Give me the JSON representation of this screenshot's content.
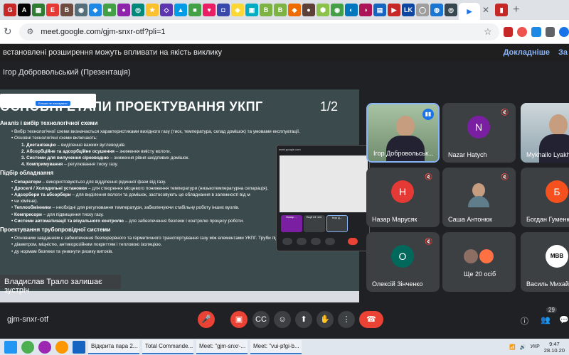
{
  "browser": {
    "url": "meet.google.com/gjm-snxr-otf?pli=1"
  },
  "banner": {
    "text": "встановлені розширення можуть впливати на якість виклику",
    "details_link": "Докладніше",
    "dismiss_link": "За"
  },
  "presenter_label": "Ігор Добровольський (Презентація)",
  "slide": {
    "title": "ОСНОВНІ ЕТАПИ ПРОЕКТУВАННЯ УКПГ",
    "page": "1/2",
    "popup_button": "Більше не показувати",
    "sections": [
      {
        "heading": "Аналіз і вибір технологічної схеми",
        "items": [
          {
            "level": 1,
            "bold": "",
            "text": "Вибір технологічної схеми визначається характеристиками вихідного газу (тиск, температура, склад домішок) та умовами експлуатації."
          },
          {
            "level": 1,
            "bold": "",
            "text": "Основні технологічні схеми включають:"
          },
          {
            "level": 2,
            "bold": "1. Деетанізацію",
            "text": " – виділення важких вуглеводнів."
          },
          {
            "level": 2,
            "bold": "2. Абсорбційне та адсорбційне осушення",
            "text": " – зниження вмісту вологи."
          },
          {
            "level": 2,
            "bold": "3. Системи для вилучення сірководню",
            "text": " – зниження рівня шкідливих домішок."
          },
          {
            "level": 2,
            "bold": "4. Компримування",
            "text": " – регулювання тиску газу."
          }
        ]
      },
      {
        "heading": "Підбір обладнання",
        "items": [
          {
            "level": 1,
            "bold": "Сепаратори",
            "text": " – використовуються для відділення рідинної фази від газу."
          },
          {
            "level": 1,
            "bold": "Дроселі / Холодильні установки",
            "text": " – для створення місцевого пониження температури (низькотемпературна сепарація)."
          },
          {
            "level": 1,
            "bold": "Адсорбери та абсорбери",
            "text": " – для виділення вологи та домішок, застосовують це обладнання в залежності від м"
          },
          {
            "level": 1,
            "bold": "",
            "text": "чи хімічне)."
          },
          {
            "level": 1,
            "bold": "Теплообмінники",
            "text": " – необхідні для регулювання температури, забезпечуючи стабільну роботу інших вузлів."
          },
          {
            "level": 1,
            "bold": "Компресори",
            "text": " – для підвищення тиску газу."
          },
          {
            "level": 1,
            "bold": "Системи автоматизації та візуального контролю",
            "text": " – для забезпечення безпеки і контролю процесу роботи."
          }
        ]
      },
      {
        "heading": "Проектування трубопровідної системи",
        "items": [
          {
            "level": 1,
            "bold": "",
            "text": "Основним завданням є забезпечення безперервного та герметичного транспортування газу між елементами УКПГ. Труби підбирають за"
          },
          {
            "level": 1,
            "bold": "",
            "text": "діаметром, міцністю, антикорозійним покриттям і тепловою ізоляцією."
          },
          {
            "level": 1,
            "bold": "",
            "text": "                                          ду нормам безпеки та уникнути ризику витоків."
          }
        ]
      }
    ]
  },
  "mini_window": {
    "title": "meet.google.com",
    "tiles": [
      "Назар ...",
      "Ещё 24 чел.",
      "Ігор Д..."
    ]
  },
  "toast": "Владислав Трало залишає зустріч",
  "participants": [
    {
      "name": "Ігор Добровольськ...",
      "initial": "",
      "color": "",
      "type": "video",
      "speaking": true
    },
    {
      "name": "Nazar Hatych",
      "initial": "N",
      "color": "#7b1fa2",
      "type": "avatar",
      "muted": true
    },
    {
      "name": "Mykhailo Lyakh",
      "initial": "",
      "color": "",
      "type": "photo2",
      "muted": false
    },
    {
      "name": "Назар Марусяк",
      "initial": "Н",
      "color": "#e53935",
      "type": "avatar",
      "muted": true
    },
    {
      "name": "Саша Антонюк",
      "initial": "",
      "color": "",
      "type": "photo3",
      "muted": true
    },
    {
      "name": "Богдан Гуменю",
      "initial": "Б",
      "color": "#f4511e",
      "type": "avatar",
      "muted": true
    },
    {
      "name": "Олексій Зінченко",
      "initial": "О",
      "color": "#00695c",
      "type": "avatar",
      "muted": true
    },
    {
      "name": "Ще 20 осіб",
      "initial": "",
      "color": "",
      "type": "more",
      "muted": false
    },
    {
      "name": "Василь Михайл",
      "initial": "МВВ",
      "color": "#fff",
      "type": "avatar-logo",
      "muted": false
    }
  ],
  "controls": {
    "meeting_code": "gjm-snxr-otf",
    "people_count": "29"
  },
  "taskbar": {
    "items": [
      "Відкрита пара 2...",
      "Total Commande...",
      "Meet: \"gjm-snxr-...",
      "Meet: \"vui-pfgi-b..."
    ],
    "lang": "УКР",
    "time": "9:47",
    "date": "28.10.20"
  },
  "colors": {
    "meet_bg": "#202124",
    "tile_bg": "#3c4043",
    "accent_red": "#ea4335",
    "accent_blue": "#8ab4f8"
  }
}
